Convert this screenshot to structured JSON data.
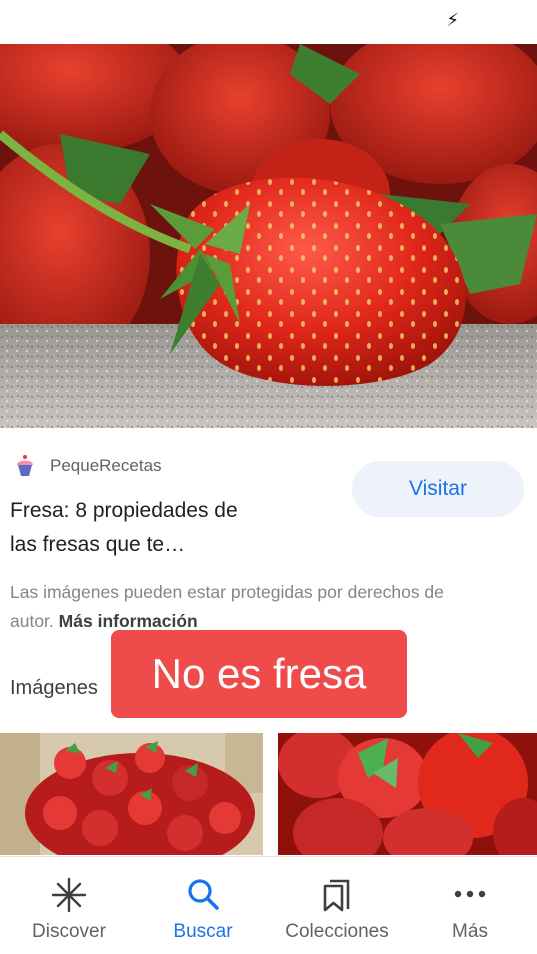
{
  "status_bar": {
    "icon": "flash-icon",
    "glyph": "⚡"
  },
  "hero_image": {
    "subject": "strawberries",
    "accent": "#d8261c"
  },
  "result": {
    "source_name": "PequeRecetas",
    "favicon": "cupcake-icon",
    "title_line1": "Fresa: 8 propiedades de",
    "title_line2": "las fresas que te…",
    "visit_label": "Visitar",
    "copyright_text": "Las imágenes pueden estar protegidas por derechos de autor.",
    "more_info_label": "Más información"
  },
  "related": {
    "heading": "Imágenes"
  },
  "overlay": {
    "label": "No es fresa",
    "color": "#f04b4b"
  },
  "bottom_nav": {
    "items": [
      {
        "label": "Discover",
        "icon": "asterisk-icon",
        "active": false
      },
      {
        "label": "Buscar",
        "icon": "search-icon",
        "active": true
      },
      {
        "label": "Colecciones",
        "icon": "bookmarks-icon",
        "active": false
      },
      {
        "label": "Más",
        "icon": "more-dots-icon",
        "active": false
      }
    ]
  },
  "colors": {
    "accent_blue": "#1a73e8",
    "visit_bg": "#eef3fb",
    "text_secondary": "#5f6368"
  }
}
